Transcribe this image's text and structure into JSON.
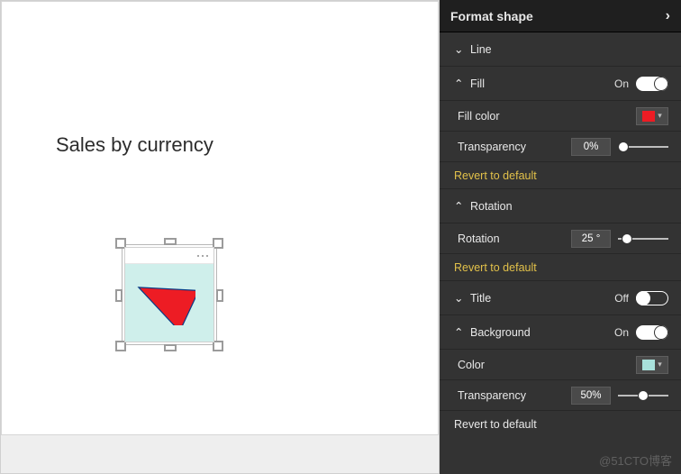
{
  "canvas": {
    "title": "Sales by currency",
    "shape": {
      "fill_color": "#ed1c24",
      "bg_color": "#a8e1db",
      "rotation_deg": 25
    }
  },
  "panel": {
    "header": "Format shape",
    "sections": {
      "line": {
        "label": "Line"
      },
      "fill": {
        "label": "Fill",
        "state": "On",
        "fill_color_label": "Fill color",
        "fill_color": "#ed1c24",
        "transparency_label": "Transparency",
        "transparency_value": "0%"
      },
      "revert1": "Revert to default",
      "rotation": {
        "label": "Rotation",
        "field_label": "Rotation",
        "value": "25 °"
      },
      "revert2": "Revert to default",
      "title_sec": {
        "label": "Title",
        "state": "Off"
      },
      "background": {
        "label": "Background",
        "state": "On",
        "color_label": "Color",
        "color": "#a8e1db",
        "transparency_label": "Transparency",
        "transparency_value": "50%"
      },
      "revert3": "Revert to default"
    }
  },
  "watermark": "@51CTO博客"
}
